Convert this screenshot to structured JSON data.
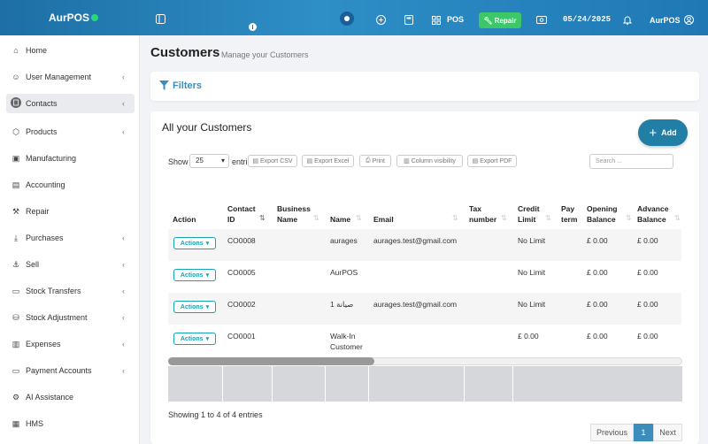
{
  "topbar": {
    "brand": "AurPOS",
    "pos_label": "POS",
    "repair_label": "Repair",
    "date": "05/24/2025",
    "user": "AurPOS",
    "icons": [
      "sidebar-toggle-icon",
      "plus-circle-icon",
      "calculator-icon",
      "grid-icon",
      "cash-icon",
      "bell-icon",
      "user-circle-icon"
    ]
  },
  "sidebar": {
    "items": [
      {
        "label": "Home",
        "icon": "home-icon",
        "chevron": false
      },
      {
        "label": "User Management",
        "icon": "users-icon",
        "chevron": true
      },
      {
        "label": "Contacts",
        "icon": "address-book-icon",
        "chevron": true,
        "active": true
      },
      {
        "label": "Products",
        "icon": "cube-icon",
        "chevron": true
      },
      {
        "label": "Manufacturing",
        "icon": "industry-icon",
        "chevron": false
      },
      {
        "label": "Accounting",
        "icon": "book-icon",
        "chevron": false
      },
      {
        "label": "Repair",
        "icon": "wrench-icon",
        "chevron": false
      },
      {
        "label": "Purchases",
        "icon": "download-icon",
        "chevron": true
      },
      {
        "label": "Sell",
        "icon": "anchor-icon",
        "chevron": true
      },
      {
        "label": "Stock Transfers",
        "icon": "truck-icon",
        "chevron": true
      },
      {
        "label": "Stock Adjustment",
        "icon": "database-icon",
        "chevron": true
      },
      {
        "label": "Expenses",
        "icon": "receipt-icon",
        "chevron": true
      },
      {
        "label": "Payment Accounts",
        "icon": "money-icon",
        "chevron": true
      },
      {
        "label": "AI Assistance",
        "icon": "robot-icon",
        "chevron": false
      },
      {
        "label": "HMS",
        "icon": "hotel-icon",
        "chevron": false
      }
    ]
  },
  "header": {
    "title": "Customers",
    "subtitle": "Manage your Customers"
  },
  "filters": {
    "label": "Filters"
  },
  "table_card": {
    "title": "All your Customers",
    "add_label": "Add",
    "show_label": "Show",
    "page_size": "25",
    "entries_label": "entri",
    "export_buttons": [
      "Export CSV",
      "Export Excel",
      "Print",
      "Column visibility",
      "Export PDF"
    ],
    "search_placeholder": "Search ...",
    "columns": [
      "Action",
      "Contact ID",
      "Business Name",
      "Name",
      "Email",
      "Tax number",
      "Credit Limit",
      "Pay term",
      "Opening Balance",
      "Advance Balance"
    ],
    "rows": [
      {
        "action": "Actions",
        "contact_id": "CO0008",
        "business_name": "",
        "name": "aurages",
        "email": "aurages.test@gmail.com",
        "tax": "",
        "credit_limit": "No Limit",
        "pay_term": "",
        "opening": "£ 0.00",
        "advance": "£ 0.00"
      },
      {
        "action": "Actions",
        "contact_id": "CO0005",
        "business_name": "",
        "name": "AurPOS",
        "email": "",
        "tax": "",
        "credit_limit": "No Limit",
        "pay_term": "",
        "opening": "£ 0.00",
        "advance": "£ 0.00"
      },
      {
        "action": "Actions",
        "contact_id": "CO0002",
        "business_name": "",
        "name": "صيانة 1",
        "email": "aurages.test@gmail.com",
        "tax": "",
        "credit_limit": "No Limit",
        "pay_term": "",
        "opening": "£ 0.00",
        "advance": "£ 0.00"
      },
      {
        "action": "Actions",
        "contact_id": "CO0001",
        "business_name": "",
        "name": "Walk-In Customer",
        "email": "",
        "tax": "",
        "credit_limit": "£ 0.00",
        "pay_term": "",
        "opening": "£ 0.00",
        "advance": "£ 0.00"
      }
    ],
    "showing": "Showing 1 to 4 of 4 entries",
    "pagination": {
      "prev": "Previous",
      "current": "1",
      "next": "Next"
    }
  }
}
